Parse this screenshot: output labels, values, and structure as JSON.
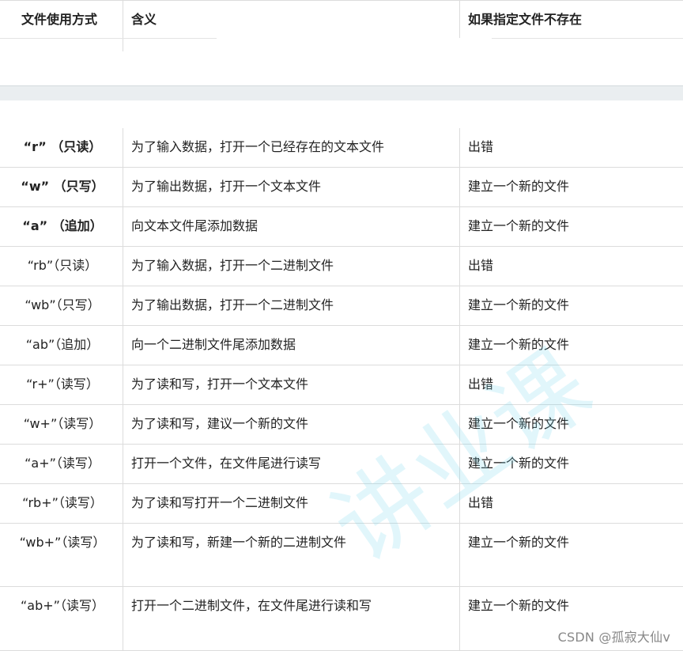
{
  "header": {
    "col_mode": "文件使用方式",
    "col_meaning": "含义",
    "col_missing": "如果指定文件不存在"
  },
  "rows": [
    {
      "mode": "“r” （只读）",
      "meaning": "为了输入数据，打开一个已经存在的文本文件",
      "missing": "出错",
      "bold": true
    },
    {
      "mode": "“w” （只写）",
      "meaning": "为了输出数据，打开一个文本文件",
      "missing": "建立一个新的文件",
      "bold": true
    },
    {
      "mode": "“a” （追加）",
      "meaning": "向文本文件尾添加数据",
      "missing": "建立一个新的文件",
      "bold": true
    },
    {
      "mode": "“rb”（只读）",
      "meaning": "为了输入数据，打开一个二进制文件",
      "missing": "出错",
      "bold": false
    },
    {
      "mode": "“wb”（只写）",
      "meaning": "为了输出数据，打开一个二进制文件",
      "missing": "建立一个新的文件",
      "bold": false
    },
    {
      "mode": "“ab”（追加）",
      "meaning": "向一个二进制文件尾添加数据",
      "missing": "建立一个新的文件",
      "bold": false
    },
    {
      "mode": "“r+”（读写）",
      "meaning": "为了读和写，打开一个文本文件",
      "missing": "出错",
      "bold": false
    },
    {
      "mode": "“w+”（读写）",
      "meaning": "为了读和写，建议一个新的文件",
      "missing": "建立一个新的文件",
      "bold": false
    },
    {
      "mode": "“a+”（读写）",
      "meaning": "打开一个文件，在文件尾进行读写",
      "missing": "建立一个新的文件",
      "bold": false
    },
    {
      "mode": "“rb+”（读写）",
      "meaning": "为了读和写打开一个二进制文件",
      "missing": "出错",
      "bold": false
    },
    {
      "mode": "“wb+”（读写）",
      "meaning": "为了读和写，新建一个新的二进制文件",
      "missing": "建立一个新的文件",
      "bold": false
    },
    {
      "mode": "“ab+”（读写）",
      "meaning": "打开一个二进制文件，在文件尾进行读和写",
      "missing": "建立一个新的文件",
      "bold": false
    }
  ],
  "watermark": "讲业课",
  "credit": "CSDN @孤寂大仙v"
}
